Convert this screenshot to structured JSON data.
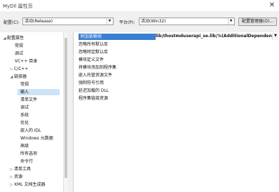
{
  "window": {
    "title": "MyDll 属性页",
    "close_glyph": "✕"
  },
  "config": {
    "config_label": "配置(C):",
    "config_value": "活动(Release)",
    "platform_label": "平台(P):",
    "platform_value": "活动(Win32)",
    "manager_button": "配置管理器(O)..."
  },
  "tree": {
    "items": [
      {
        "toggle": "◢",
        "label": "配置属性"
      },
      {
        "toggle": "",
        "label": "常规"
      },
      {
        "toggle": "",
        "label": "调试"
      },
      {
        "toggle": "",
        "label": "VC++ 目录"
      },
      {
        "toggle": "▷",
        "label": "C/C++"
      },
      {
        "toggle": "◢",
        "label": "链接器"
      },
      {
        "toggle": "",
        "label": "常规"
      },
      {
        "toggle": "",
        "label": "输入"
      },
      {
        "toggle": "",
        "label": "清单文件"
      },
      {
        "toggle": "",
        "label": "调试"
      },
      {
        "toggle": "",
        "label": "系统"
      },
      {
        "toggle": "",
        "label": "优化"
      },
      {
        "toggle": "",
        "label": "嵌入的 IDL"
      },
      {
        "toggle": "",
        "label": "Windows 元数据"
      },
      {
        "toggle": "",
        "label": "高级"
      },
      {
        "toggle": "",
        "label": "所有选项"
      },
      {
        "toggle": "",
        "label": "命令行"
      },
      {
        "toggle": "▷",
        "label": "清单工具"
      },
      {
        "toggle": "▷",
        "label": "资源"
      },
      {
        "toggle": "▷",
        "label": "XML 文档生成器"
      }
    ]
  },
  "properties": {
    "rows": [
      {
        "name": "附加依赖项"
      },
      {
        "name": "忽略所有默认库"
      },
      {
        "name": "忽略特定默认库"
      },
      {
        "name": "模块定义文件"
      },
      {
        "name": "将模块添加到程序集"
      },
      {
        "name": "嵌入托管资源文件"
      },
      {
        "name": "强制符号引用"
      },
      {
        "name": "延迟加载的 DLL"
      },
      {
        "name": "程序集链接资源"
      }
    ],
    "selected_value": "lib;thostmduserapi_se.lib;%(AdditionalDependencies)",
    "value_dropdown_glyph": "▼"
  }
}
